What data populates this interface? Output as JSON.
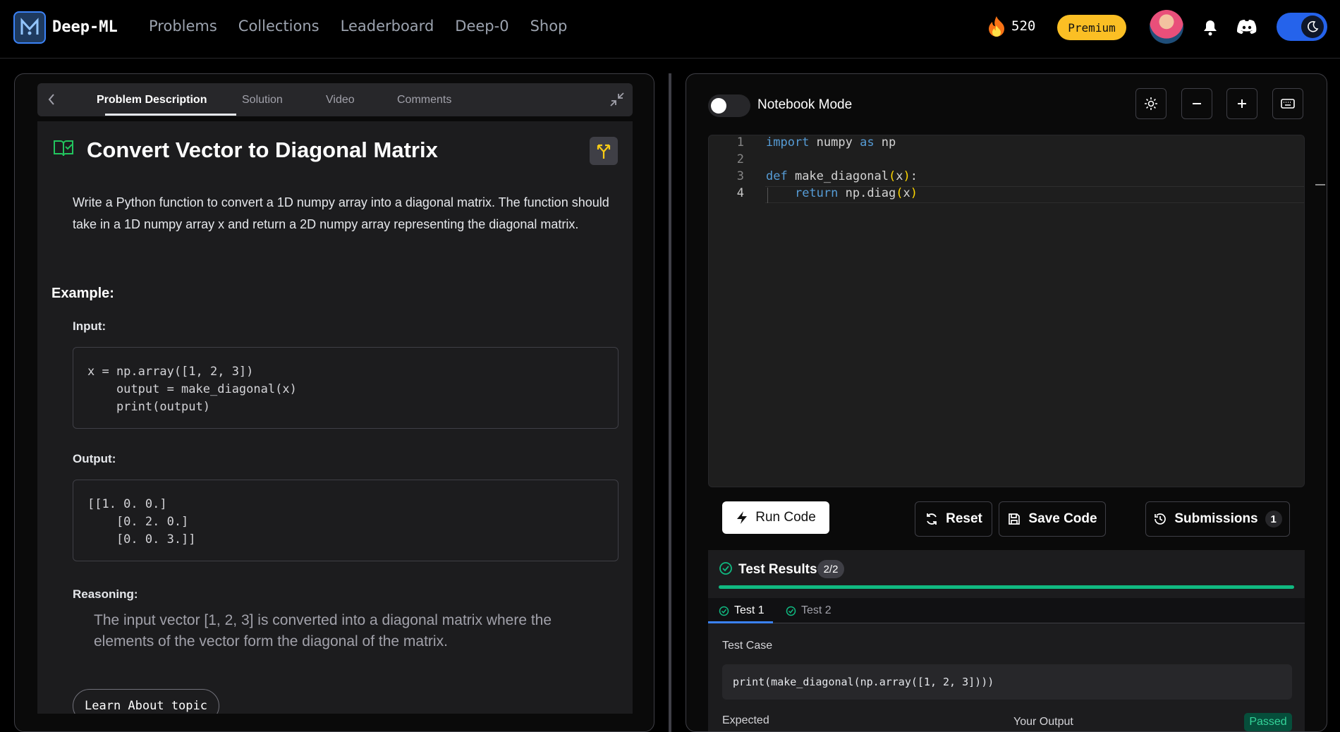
{
  "nav": {
    "brand": "Deep-ML",
    "items": [
      "Problems",
      "Collections",
      "Leaderboard",
      "Deep-0",
      "Shop"
    ],
    "streak": "520",
    "premium": "Premium"
  },
  "problem": {
    "tabs": [
      "Problem Description",
      "Solution",
      "Video",
      "Comments"
    ],
    "title": "Convert Vector to Diagonal Matrix",
    "description": "Write a Python function to convert a 1D numpy array into a diagonal matrix. The function should take in a 1D numpy array x and return a 2D numpy array representing the diagonal matrix.",
    "example_heading": "Example:",
    "input_label": "Input:",
    "input_code": "x = np.array([1, 2, 3])\n    output = make_diagonal(x)\n    print(output)",
    "output_label": "Output:",
    "output_code": "[[1. 0. 0.]\n    [0. 2. 0.]\n    [0. 0. 3.]]",
    "reasoning_label": "Reasoning:",
    "reasoning": "The input vector [1, 2, 3] is converted into a diagonal matrix where the elements of the vector form the diagonal of the matrix.",
    "learn_button": "Learn About topic"
  },
  "editor": {
    "notebook_label": "Notebook Mode",
    "line_numbers": [
      "1",
      "2",
      "3",
      "4"
    ],
    "run": "Run Code",
    "reset": "Reset",
    "save": "Save Code",
    "submissions": "Submissions",
    "submissions_count": "1"
  },
  "results": {
    "title": "Test Results",
    "badge": "2/2",
    "progress": 1.0,
    "tests": [
      "Test 1",
      "Test 2"
    ],
    "test_case_label": "Test Case",
    "test_case": "print(make_diagonal(np.array([1, 2, 3])))",
    "expected_label": "Expected",
    "your_output_label": "Your Output",
    "status": "Passed"
  },
  "colors": {
    "accent_blue": "#2563eb",
    "premium_yellow": "#fbbf24",
    "success_green": "#10b981"
  }
}
